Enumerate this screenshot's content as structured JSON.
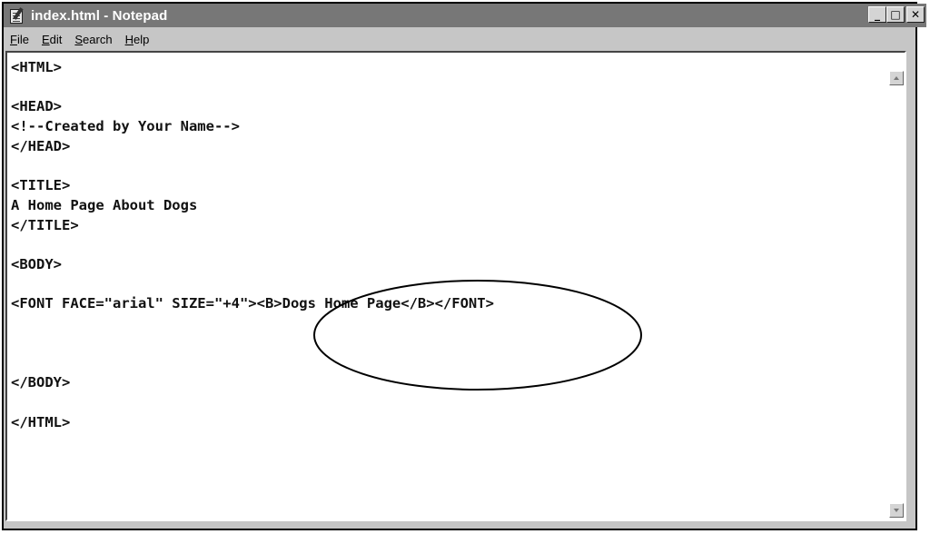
{
  "window": {
    "title": "index.html - Notepad"
  },
  "title_buttons": {
    "minimize": "_",
    "maximize": "□",
    "close": "✕"
  },
  "menu": {
    "file": {
      "underlined": "F",
      "rest": "ile"
    },
    "edit": {
      "underlined": "E",
      "rest": "dit"
    },
    "search": {
      "underlined": "S",
      "rest": "earch"
    },
    "help": {
      "underlined": "H",
      "rest": "elp"
    }
  },
  "editor": {
    "content": "<HTML>\n\n<HEAD>\n<!--Created by Your Name-->\n</HEAD>\n\n<TITLE>\nA Home Page About Dogs\n</TITLE>\n\n<BODY>\n\n<FONT FACE=\"arial\" SIZE=\"+4\"><B>Dogs Home Page</B></FONT>\n\n\n\n</BODY>\n\n</HTML>"
  },
  "icons": {
    "app": "notepad-icon",
    "annotation": "highlight-ellipse"
  }
}
